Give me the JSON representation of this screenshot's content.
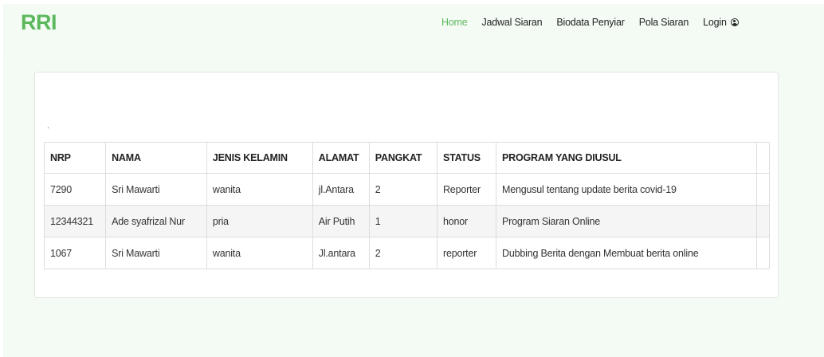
{
  "brand": "RRI",
  "nav": {
    "home": "Home",
    "jadwal": "Jadwal Siaran",
    "biodata": "Biodata Penyiar",
    "pola": "Pola Siaran",
    "login": "Login"
  },
  "card": {
    "mark": "."
  },
  "table": {
    "headers": [
      "NRP",
      "NAMA",
      "JENIS KELAMIN",
      "ALAMAT",
      "PANGKAT",
      "STATUS",
      "PROGRAM YANG DIUSUL"
    ],
    "rows": [
      [
        "7290",
        "Sri Mawarti",
        "wanita",
        "jl.Antara",
        "2",
        "Reporter",
        "Mengusul tentang update berita covid-19"
      ],
      [
        "12344321",
        "Ade syafrizal Nur",
        "pria",
        "Air Putih",
        "1",
        "honor",
        "Program Siaran Online"
      ],
      [
        "1067",
        "Sri Mawarti",
        "wanita",
        "Jl.antara",
        "2",
        "reporter",
        "Dubbing Berita dengan Membuat berita online"
      ]
    ]
  },
  "colors": {
    "accent": "#5cb85c",
    "page_bg": "#f3fbf4"
  },
  "icons": {
    "login": "user-circle-icon"
  }
}
